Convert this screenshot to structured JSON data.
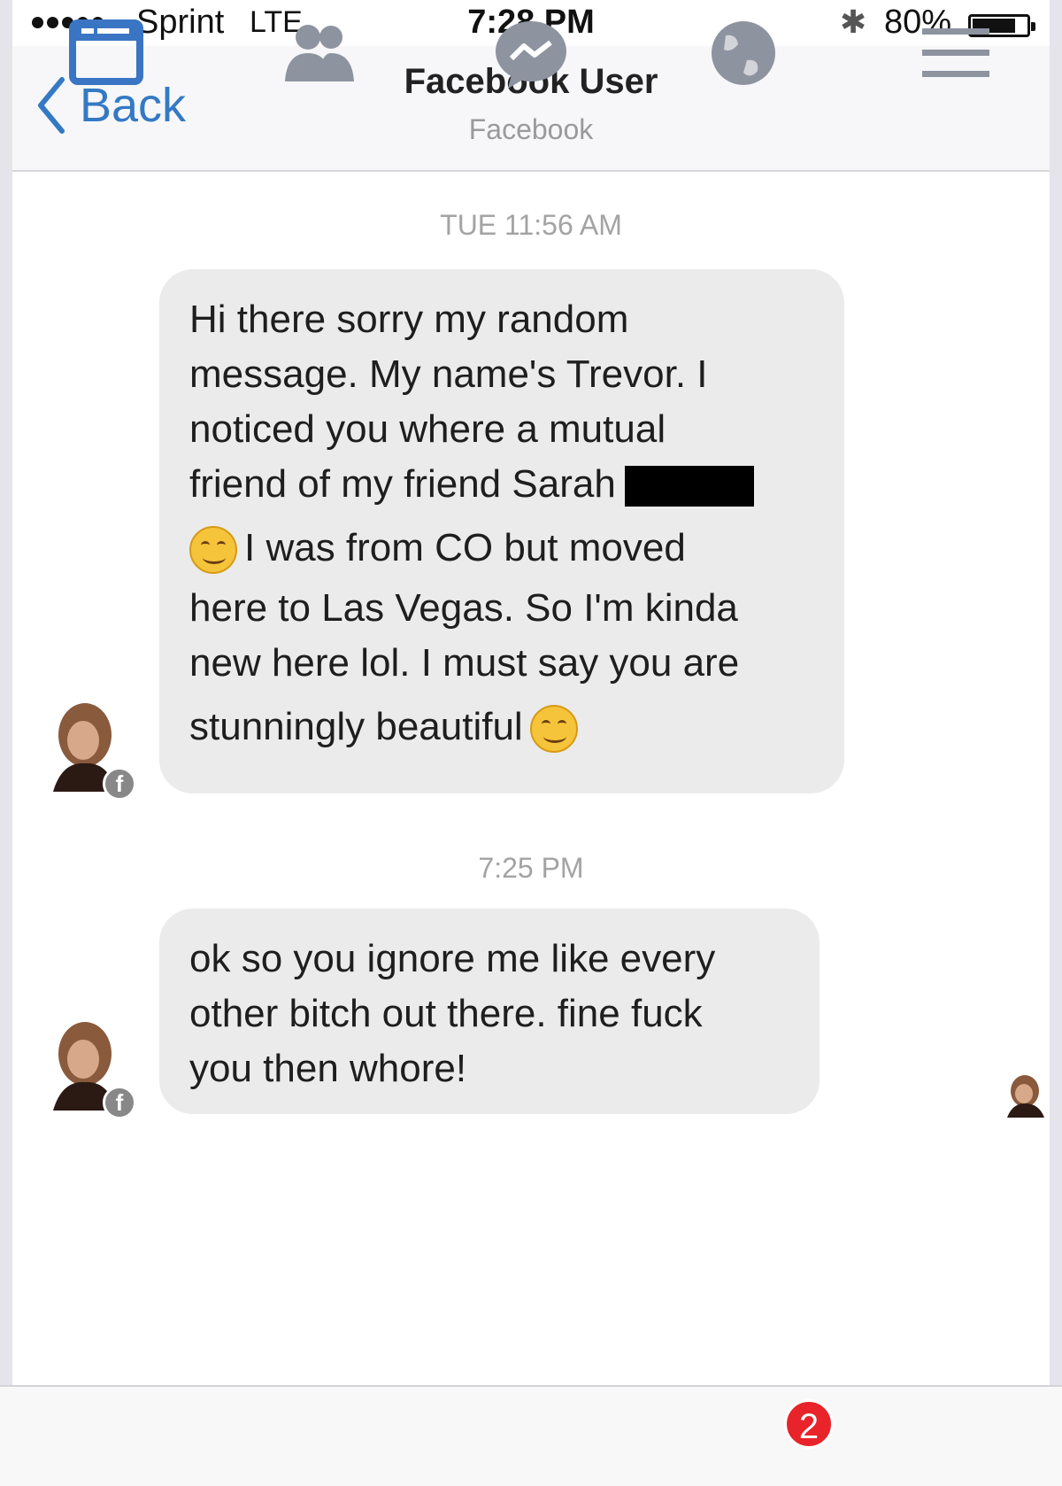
{
  "status_bar": {
    "carrier": "Sprint",
    "network": "LTE",
    "time": "7:28 PM",
    "battery_percent": "80%",
    "battery_level": 0.8,
    "signal_bars": 5
  },
  "nav": {
    "back_label": "Back",
    "title": "Facebook User",
    "subtitle": "Facebook"
  },
  "messages": [
    {
      "timestamp": "TUE 11:56 AM",
      "lines": [
        "Hi there sorry my random",
        "message. My name's Trevor. I",
        "noticed you where a mutual",
        "friend of my friend Sarah"
      ],
      "line5": "I was from CO but moved",
      "lines_rest": [
        "here to Las Vegas. So I'm kinda",
        "new here lol. I must say you are"
      ],
      "last": "stunningly beautiful"
    },
    {
      "timestamp": "7:25 PM",
      "lines": [
        "ok so you ignore me like every",
        "other bitch out there. fine fuck",
        "you then whore!"
      ]
    }
  ],
  "tab_bar": {
    "items": [
      "news-feed-icon",
      "friends-icon",
      "messenger-icon",
      "notifications-globe-icon",
      "menu-icon"
    ],
    "notifications_badge": "2"
  },
  "colors": {
    "accent": "#3479c4",
    "badge": "#e8232a",
    "bubble": "#ebebeb"
  }
}
